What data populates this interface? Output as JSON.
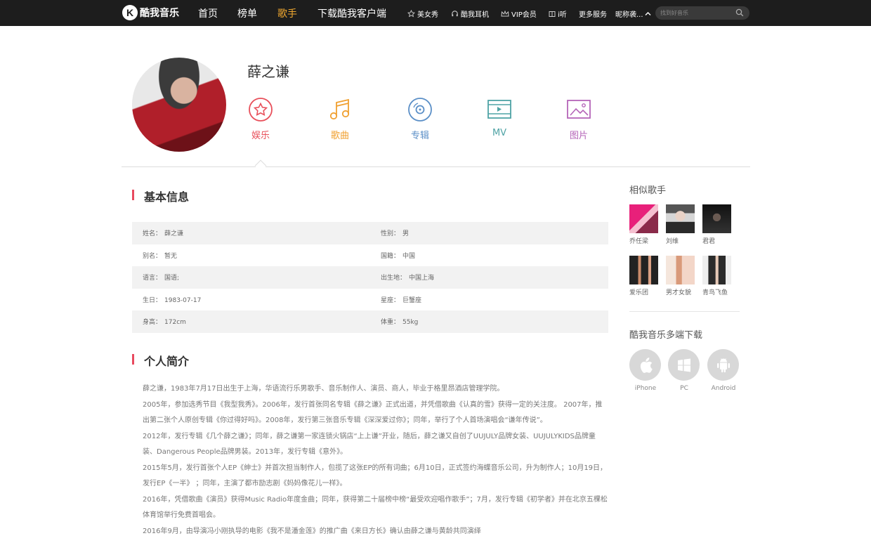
{
  "topbar": {
    "logo_text": "酷我音乐",
    "nav": [
      "首页",
      "榜单",
      "歌手",
      "下载酷我客户端"
    ],
    "active_nav": "歌手",
    "links": [
      "美女秀",
      "酷我耳机",
      "VIP会员",
      "i听",
      "更多服务",
      "昵称袭..."
    ],
    "search_placeholder": "找到好音乐"
  },
  "artist": {
    "name": "薛之谦",
    "tabs": [
      {
        "label": "娱乐",
        "color": "#e8505b",
        "icon": "star-icon"
      },
      {
        "label": "歌曲",
        "color": "#f0a030",
        "icon": "music-note-icon"
      },
      {
        "label": "专辑",
        "color": "#5b8fc7",
        "icon": "disc-icon"
      },
      {
        "label": "MV",
        "color": "#4fa3a5",
        "icon": "video-icon"
      },
      {
        "label": "图片",
        "color": "#b565b8",
        "icon": "image-icon"
      }
    ]
  },
  "basic_info": {
    "title": "基本信息",
    "rows": [
      [
        {
          "k": "姓名：",
          "v": "薛之谦"
        },
        {
          "k": "性别：",
          "v": "男"
        }
      ],
      [
        {
          "k": "别名：",
          "v": "暂无"
        },
        {
          "k": "国籍：",
          "v": "中国"
        }
      ],
      [
        {
          "k": "语言：",
          "v": "国语;"
        },
        {
          "k": "出生地：",
          "v": "中国上海"
        }
      ],
      [
        {
          "k": "生日：",
          "v": "1983-07-17"
        },
        {
          "k": "星座：",
          "v": "巨蟹座"
        }
      ],
      [
        {
          "k": "身高：",
          "v": "172cm"
        },
        {
          "k": "体重：",
          "v": "55kg"
        }
      ]
    ]
  },
  "bio": {
    "title": "个人简介",
    "lines": [
      "薛之谦，1983年7月17日出生于上海，华语流行乐男歌手、音乐制作人、演员、商人，毕业于格里昂酒店管理学院。",
      "2005年，参加选秀节目《我型我秀》。2006年，发行首张同名专辑《薛之谦》正式出道，并凭借歌曲《认真的雪》获得一定的关注度。 2007年，推出第二张个人原创专辑《你过得好吗》。2008年，发行第三张音乐专辑《深深爱过你》；同年，举行了个人首场演唱会“谦年传说”。",
      "2012年，发行专辑《几个薛之谦》；同年，薛之谦第一家连锁火锅店“上上谦”开业，随后，薛之谦又自创了UUJULY品牌女装、UUJULYKIDS品牌童装、Dangerous People品牌男装。2013年，发行专辑《意外》。",
      "2015年5月，发行首张个人EP《绅士》并首次担当制作人，包揽了这张EP的所有词曲；6月10日，正式签约海蝶音乐公司，升为制作人；10月19日，发行EP《一半》 ；同年，主演了都市励志剧《妈妈像花儿一样》。",
      "2016年，凭借歌曲《演员》获得Music Radio年度金曲；同年，获得第二十届榜中榜“最受欢迎唱作歌手”；7月，发行专辑《初学者》并在北京五棵松体育馆举行免费首唱会。",
      "2016年9月，由导演冯小刚执导的电影《我不是潘金莲》的推广曲《来日方长》确认由薛之谦与黄龄共同演绎"
    ]
  },
  "sidebar": {
    "similar_title": "相似歌手",
    "similar": [
      {
        "name": "乔任梁",
        "c1": "#e8207a",
        "c2": "#f5c0d0"
      },
      {
        "name": "刘维",
        "c1": "#cfcfcf",
        "c2": "#2a2a2a"
      },
      {
        "name": "君君",
        "c1": "#1a1a1a",
        "c2": "#444444"
      },
      {
        "name": "爱乐团",
        "c1": "#2a2a2a",
        "c2": "#c98a6a"
      },
      {
        "name": "男才女貌",
        "c1": "#f3d6c8",
        "c2": "#d99a7a"
      },
      {
        "name": "青鸟飞鱼",
        "c1": "#eeeeee",
        "c2": "#333333"
      }
    ],
    "download_title": "酷我音乐多端下载",
    "downloads": [
      {
        "label": "iPhone",
        "icon": "apple-icon"
      },
      {
        "label": "PC",
        "icon": "windows-icon"
      },
      {
        "label": "Android",
        "icon": "android-icon"
      }
    ]
  }
}
